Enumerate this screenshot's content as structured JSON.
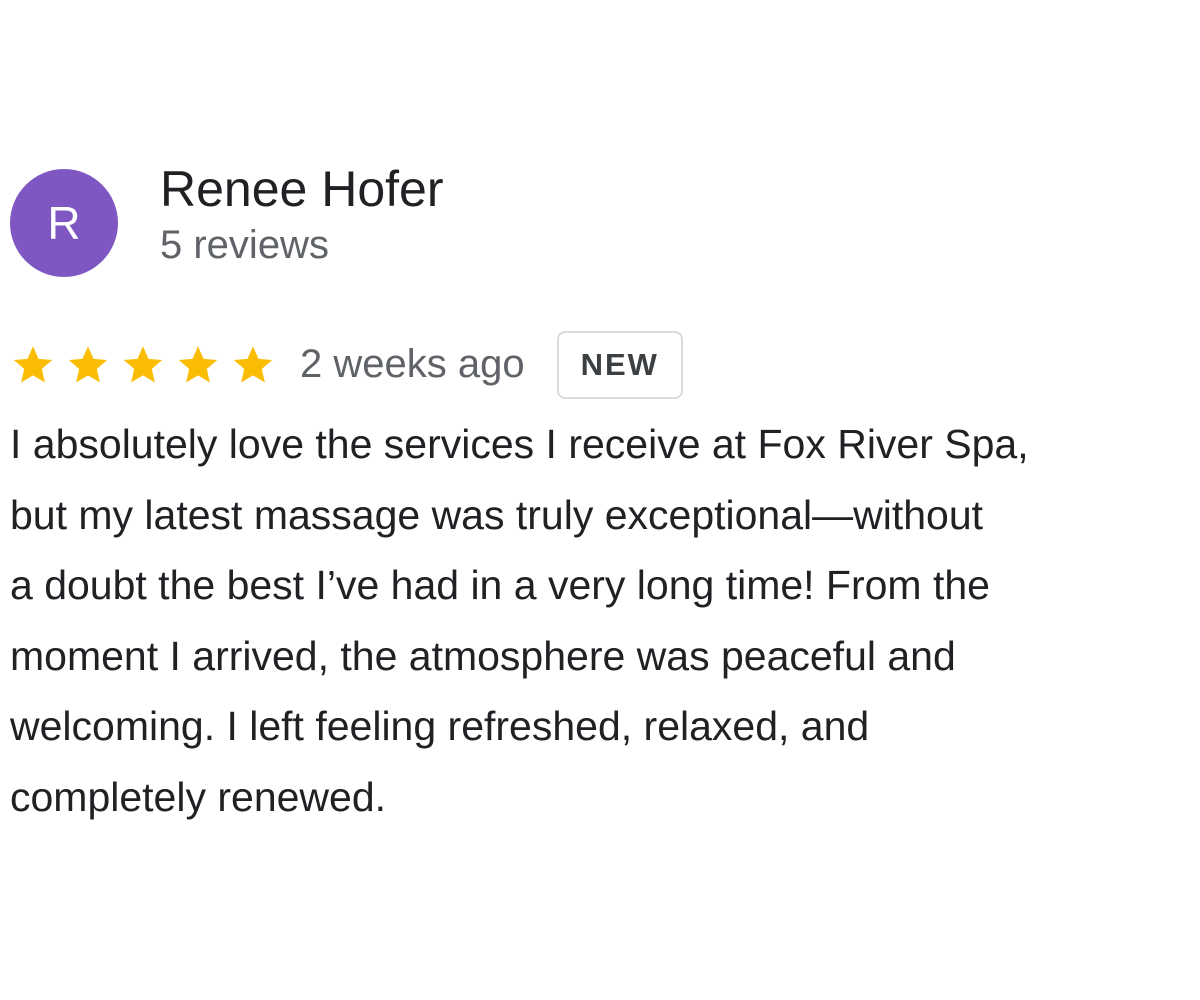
{
  "review": {
    "author": {
      "initial": "R",
      "name": "Renee Hofer",
      "meta": "5 reviews",
      "avatar_color": "#7e57c2"
    },
    "rating": {
      "stars": 5,
      "max_stars": 5,
      "star_color": "#fbbc04",
      "star_icon": "star-icon"
    },
    "timestamp": "2 weeks ago",
    "badge": "NEW",
    "text": "I absolutely love the services I receive at Fox River Spa,\nbut my latest massage was truly exceptional—without\na doubt the best I’ve had in a very long time! From the\nmoment I arrived, the atmosphere was peaceful and\nwelcoming. I left  feeling refreshed, relaxed, and\ncompletely renewed."
  }
}
